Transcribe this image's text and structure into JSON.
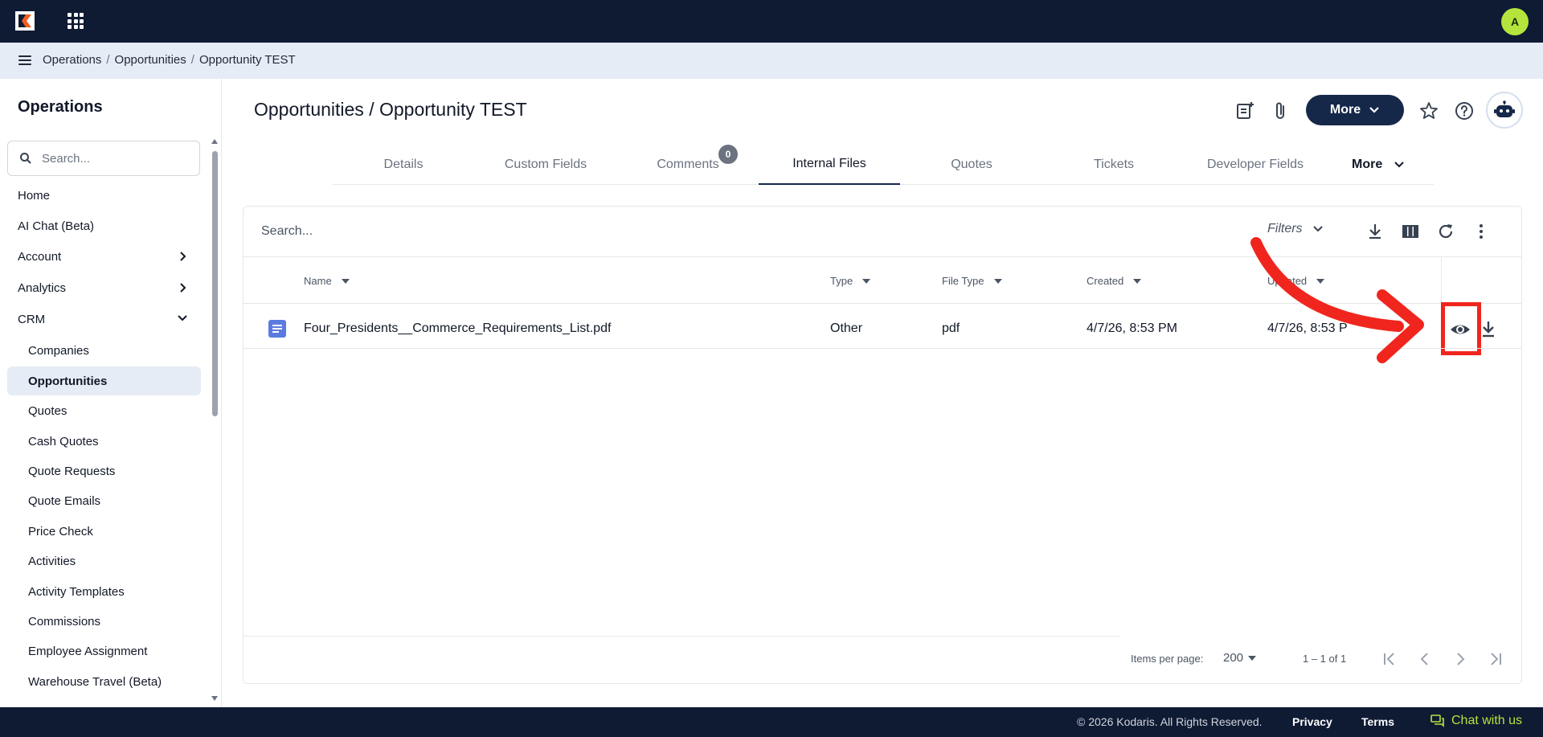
{
  "topbar": {
    "avatar_initial": "A",
    "apps_icon": "apps-grid-icon",
    "logo": "kodaris-logo"
  },
  "breadcrumb": {
    "items": [
      "Operations",
      "Opportunities",
      "Opportunity TEST"
    ],
    "separator": "/"
  },
  "sidebar": {
    "title": "Operations",
    "search_placeholder": "Search...",
    "items": [
      {
        "label": "Home"
      },
      {
        "label": "AI Chat (Beta)"
      },
      {
        "label": "Account"
      },
      {
        "label": "Analytics"
      },
      {
        "label": "CRM"
      }
    ],
    "crm_items": [
      {
        "label": "Companies"
      },
      {
        "label": "Opportunities"
      },
      {
        "label": "Quotes"
      },
      {
        "label": "Cash Quotes"
      },
      {
        "label": "Quote Requests"
      },
      {
        "label": "Quote Emails"
      },
      {
        "label": "Price Check"
      },
      {
        "label": "Activities"
      },
      {
        "label": "Activity Templates"
      },
      {
        "label": "Commissions"
      },
      {
        "label": "Employee Assignment"
      },
      {
        "label": "Warehouse Travel (Beta)"
      }
    ],
    "active_item": "Opportunities"
  },
  "header": {
    "title": "Opportunities / Opportunity TEST",
    "more_label": "More"
  },
  "tabs": {
    "items": [
      {
        "label": "Details"
      },
      {
        "label": "Custom Fields"
      },
      {
        "label": "Comments",
        "badge": "0"
      },
      {
        "label": "Internal Files"
      },
      {
        "label": "Quotes"
      },
      {
        "label": "Tickets"
      },
      {
        "label": "Developer Fields"
      }
    ],
    "more_label": "More",
    "active": "Internal Files"
  },
  "files": {
    "search_placeholder": "Search...",
    "filters_label": "Filters",
    "columns": [
      "Name",
      "Type",
      "File Type",
      "Created",
      "Updated"
    ],
    "rows": [
      {
        "name": "Four_Presidents__Commerce_Requirements_List.pdf",
        "type": "Other",
        "file_type": "pdf",
        "created": "4/7/26, 8:53 PM",
        "updated": "4/7/26, 8:53 PM"
      }
    ],
    "pager": {
      "label": "Items per page:",
      "per_page": "200",
      "range": "1 – 1 of 1"
    }
  },
  "footer": {
    "copyright": "© 2026 Kodaris. All Rights Reserved.",
    "privacy": "Privacy",
    "terms": "Terms",
    "chat": "Chat with us"
  },
  "colors": {
    "navy": "#0f1a33",
    "button_navy": "#16284a",
    "accent_lime": "#b5e53c",
    "highlight_red": "#f0261e",
    "nav_active_bg": "#e6ecf6"
  }
}
